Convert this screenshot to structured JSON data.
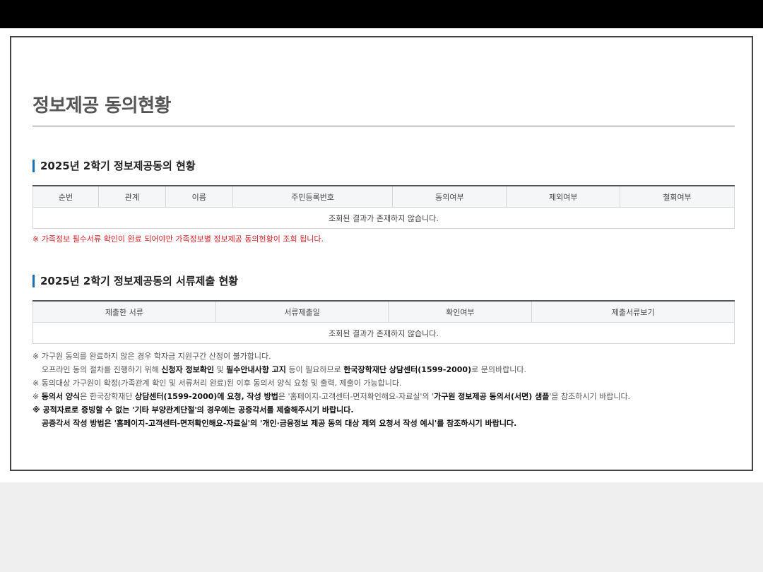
{
  "page_title": "정보제공 동의현황",
  "section1": {
    "title": "2025년 2학기 정보제공동의 현황",
    "columns": [
      "순번",
      "관계",
      "이름",
      "주민등록번호",
      "동의여부",
      "제외여부",
      "철회여부"
    ],
    "empty_message": "조회된 결과가 존재하지 않습니다.",
    "warning": "※ 가족정보 필수서류 확인이 완료 되어야만 가족정보별 정보제공 동의현황이 조회 됩니다."
  },
  "section2": {
    "title": "2025년 2학기 정보제공동의 서류제출 현황",
    "columns": [
      "제출한 서류",
      "서류제출일",
      "확인여부",
      "제출서류보기"
    ],
    "empty_message": "조회된 결과가 존재하지 않습니다."
  },
  "notes": {
    "n1": "※ 가구원 동의를 완료하지 않은 경우 학자금 지원구간 산정이 불가합니다.",
    "n2": {
      "a": "오프라인 동의 절차를 진행하기 위해 ",
      "b": "신청자 정보확인",
      "c": " 및 ",
      "d": "필수안내사항 고지",
      "e": " 등이 필요하므로 ",
      "f": "한국장학재단 상담센터(1599-2000)",
      "g": "로 문의바랍니다."
    },
    "n3": "※ 동의대상 가구원이 확정(가족관계 확인 및 서류처리 완료)된 이후 동의서 양식 요청 및 출력, 제출이 가능합니다.",
    "n4": {
      "a": "※ ",
      "b": "동의서 양식",
      "c": "은 한국장학재단 ",
      "d": "상담센터(1599-2000)에 요청, 작성 방법",
      "e": "은 '홈페이지-고객센터-면저확인해요-자료실'의 '",
      "f": "가구원 정보제공 동의서(서면) 샘플",
      "g": "'을 참조하시기 바랍니다."
    },
    "n5": "※ 공적자료로 증빙할 수 없는 '기타 부양관계단절'의 경우에는 공증각서를 제출해주시기 바랍니다.",
    "n6": "공증각서 작성 방법은 '홈페이지-고객센터-면저확인해요-자료실'의 '개인·금융정보 제공 동의 대상 제외 요청서 작성 예시'를 참조하시기 바랍니다."
  }
}
